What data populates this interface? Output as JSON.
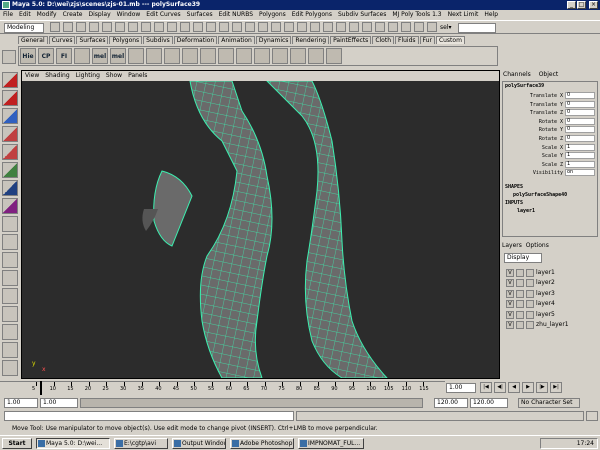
{
  "window": {
    "title": "Maya 5.0: D:\\wei\\zjs\\scenes\\zjs-01.mb  ---  polySurface39",
    "buttons": [
      "_",
      "□",
      "×"
    ]
  },
  "menubar": [
    "File",
    "Edit",
    "Modify",
    "Create",
    "Display",
    "Window",
    "Edit Curves",
    "Surfaces",
    "Edit NURBS",
    "Polygons",
    "Edit Polygons",
    "Subdiv Surfaces",
    "MJ Poly Tools 1.3",
    "Next Limit",
    "Help"
  ],
  "statusline": {
    "mode": "Modeling",
    "sel_label": "sel▾"
  },
  "shelf": {
    "tabs": [
      "General",
      "Curves",
      "Surfaces",
      "Polygons",
      "Subdivs",
      "Deformation",
      "Animation",
      "Dynamics",
      "Rendering",
      "PaintEffects",
      "Cloth",
      "Fluids",
      "Fur",
      "Custom"
    ],
    "active_tab": "Custom",
    "icons": [
      "Hie",
      "CP",
      "FI",
      "",
      "mel",
      "mel",
      "",
      "",
      "",
      "",
      "",
      "",
      "",
      "",
      "",
      "",
      "",
      ""
    ]
  },
  "viewport": {
    "menu": [
      "View",
      "Shading",
      "Lighting",
      "Show",
      "Panels"
    ],
    "axis_x": "x",
    "axis_y": "y"
  },
  "channelbox": {
    "tabs": [
      "Channels",
      "Object"
    ],
    "object": "polySurface39",
    "attributes": [
      {
        "label": "Translate X",
        "value": "0"
      },
      {
        "label": "Translate Y",
        "value": "0"
      },
      {
        "label": "Translate Z",
        "value": "0"
      },
      {
        "label": "Rotate X",
        "value": "0"
      },
      {
        "label": "Rotate Y",
        "value": "0"
      },
      {
        "label": "Rotate Z",
        "value": "0"
      },
      {
        "label": "Scale X",
        "value": "1"
      },
      {
        "label": "Scale Y",
        "value": "1"
      },
      {
        "label": "Scale Z",
        "value": "1"
      },
      {
        "label": "Visibility",
        "value": "on"
      }
    ],
    "shapes_header": "SHAPES",
    "shape": "polySurfaceShape40",
    "inputs_header": "INPUTS",
    "input": "layer1"
  },
  "layers": {
    "tabs": [
      "Layers",
      "Options"
    ],
    "display": "Display",
    "items": [
      {
        "v": "V",
        "name": "layer1"
      },
      {
        "v": "V",
        "name": "layer2"
      },
      {
        "v": "V",
        "name": "layer3"
      },
      {
        "v": "V",
        "name": "layer4"
      },
      {
        "v": "V",
        "name": "layer5"
      },
      {
        "v": "V",
        "name": "zhu_layer1"
      }
    ]
  },
  "timeline": {
    "ticks": [
      "5",
      "10",
      "15",
      "20",
      "25",
      "30",
      "35",
      "40",
      "45",
      "50",
      "55",
      "60",
      "65",
      "70",
      "75",
      "80",
      "85",
      "90",
      "95",
      "100",
      "105",
      "110",
      "115"
    ],
    "current_frame": "1.00"
  },
  "range": {
    "start": "1.00",
    "start2": "1.00",
    "end": "120.00",
    "end2": "120.00",
    "character_set": "No Character Set"
  },
  "helpline": "Move Tool: Use manipulator to move object(s). Use edit mode to change pivot (INSERT).  Ctrl+LMB to move perpendicular.",
  "taskbar": {
    "start": "Start",
    "tasks": [
      "Maya 5.0: D:\\wei...",
      "E:\\cgtp\\avi",
      "Output Window",
      "Adobe Photoshop",
      "IMPNOMAT_FUL..."
    ],
    "clock": "17:24"
  },
  "colors": {
    "viewport_bg": "#2c2c2c",
    "wire": "#3cf0b0",
    "mesh": "#6a6a6a",
    "titlebar": "#0a246a"
  }
}
